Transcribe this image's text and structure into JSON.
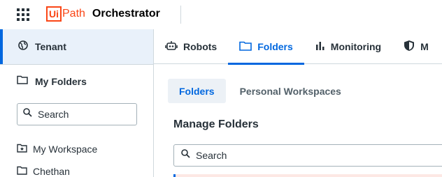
{
  "header": {
    "logo_box": "Ui",
    "logo_path": "Path",
    "product": "Orchestrator"
  },
  "sidebar": {
    "tenant_label": "Tenant",
    "my_folders_label": "My Folders",
    "search_placeholder": "Search",
    "tree": [
      {
        "label": "My Workspace",
        "icon": "workspace-folder-icon"
      },
      {
        "label": "Chethan",
        "icon": "folder-icon"
      }
    ]
  },
  "nav": {
    "tabs": [
      {
        "label": "Robots",
        "icon": "robot-icon"
      },
      {
        "label": "Folders",
        "icon": "folder-icon",
        "active": true
      },
      {
        "label": "Monitoring",
        "icon": "bar-chart-icon"
      },
      {
        "label": "M",
        "icon": "shield-icon"
      }
    ]
  },
  "subtabs": [
    {
      "label": "Folders",
      "active": true
    },
    {
      "label": "Personal Workspaces"
    }
  ],
  "main": {
    "title": "Manage Folders",
    "search_placeholder": "Search"
  },
  "colors": {
    "accent": "#0067df",
    "brand": "#fa4616",
    "selected_bg": "#e9f1fa"
  }
}
